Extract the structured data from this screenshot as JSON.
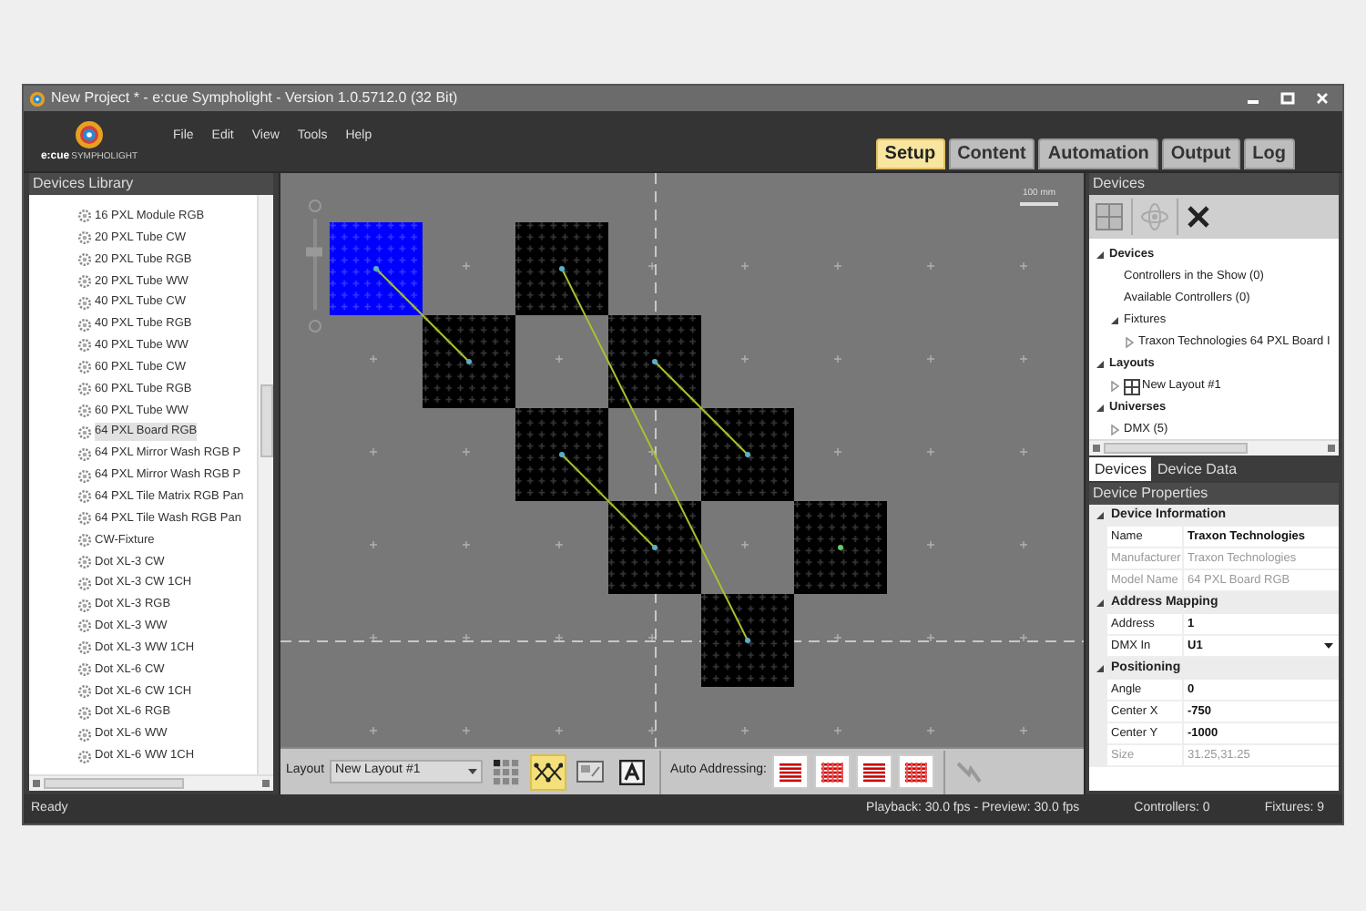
{
  "window": {
    "title": "New Project * - e:cue Sympholight - Version 1.0.5712.0 (32 Bit)"
  },
  "logo": {
    "brand": "e:cue",
    "product": "SYMPHOLIGHT"
  },
  "menu": [
    "File",
    "Edit",
    "View",
    "Tools",
    "Help"
  ],
  "tabs": [
    {
      "label": "Setup",
      "selected": true
    },
    {
      "label": "Content",
      "selected": false
    },
    {
      "label": "Automation",
      "selected": false
    },
    {
      "label": "Output",
      "selected": false
    },
    {
      "label": "Log",
      "selected": false
    }
  ],
  "library": {
    "title": "Devices Library",
    "items": [
      {
        "label": "16 PXL Module RGB",
        "selected": false
      },
      {
        "label": "20 PXL Tube CW",
        "selected": false
      },
      {
        "label": "20 PXL Tube RGB",
        "selected": false
      },
      {
        "label": "20 PXL Tube WW",
        "selected": false
      },
      {
        "label": "40 PXL Tube CW",
        "selected": false
      },
      {
        "label": "40 PXL Tube RGB",
        "selected": false
      },
      {
        "label": "40 PXL Tube WW",
        "selected": false
      },
      {
        "label": "60 PXL Tube CW",
        "selected": false
      },
      {
        "label": "60 PXL Tube RGB",
        "selected": false
      },
      {
        "label": "60 PXL Tube WW",
        "selected": false
      },
      {
        "label": "64 PXL Board RGB",
        "selected": true
      },
      {
        "label": "64 PXL Mirror Wash RGB P",
        "selected": false
      },
      {
        "label": "64 PXL Mirror Wash RGB P",
        "selected": false
      },
      {
        "label": "64 PXL Tile Matrix RGB Pan",
        "selected": false
      },
      {
        "label": "64 PXL Tile Wash RGB Pan",
        "selected": false
      },
      {
        "label": "CW-Fixture",
        "selected": false
      },
      {
        "label": "Dot XL-3 CW",
        "selected": false
      },
      {
        "label": "Dot XL-3 CW 1CH",
        "selected": false
      },
      {
        "label": "Dot XL-3 RGB",
        "selected": false
      },
      {
        "label": "Dot XL-3 WW",
        "selected": false
      },
      {
        "label": "Dot XL-3 WW 1CH",
        "selected": false
      },
      {
        "label": "Dot XL-6 CW",
        "selected": false
      },
      {
        "label": "Dot XL-6 CW 1CH",
        "selected": false
      },
      {
        "label": "Dot XL-6 RGB",
        "selected": false
      },
      {
        "label": "Dot XL-6 WW",
        "selected": false
      },
      {
        "label": "Dot XL-6 WW 1CH",
        "selected": false
      }
    ]
  },
  "canvas": {
    "scale": "100 mm",
    "zoom": {
      "level": 0.65
    },
    "fixtures": [
      {
        "selected": true
      },
      {
        "selected": false
      },
      {
        "selected": false
      },
      {
        "selected": false
      },
      {
        "selected": false
      },
      {
        "selected": false
      },
      {
        "selected": false
      },
      {
        "selected": false
      },
      {
        "selected": false
      }
    ]
  },
  "layout_toolbar": {
    "label": "Layout",
    "layout": "New Layout #1",
    "tools": [
      {
        "kind": "grid",
        "selected": false
      },
      {
        "kind": "wiring",
        "selected": true
      },
      {
        "kind": "image",
        "selected": false
      },
      {
        "kind": "text",
        "selected": false
      }
    ],
    "auto_label": "Auto Addressing:"
  },
  "devices_panel": {
    "title": "Devices",
    "tree": [
      {
        "label": "Devices",
        "expanded": true,
        "children": [
          {
            "label": "Controllers in the Show (0)"
          },
          {
            "label": "Available Controllers (0)"
          },
          {
            "label": "Fixtures",
            "expanded": true,
            "children": [
              {
                "label": "Traxon Technologies 64 PXL Board I",
                "expanded": false
              }
            ]
          }
        ]
      },
      {
        "label": "Layouts",
        "expanded": true,
        "children": [
          {
            "label": "New Layout #1",
            "expanded": false,
            "kind": "layout"
          }
        ]
      },
      {
        "label": "Universes",
        "expanded": true,
        "children": [
          {
            "label": "DMX (5)",
            "expanded": false
          }
        ]
      }
    ],
    "tabs": [
      {
        "label": "Devices",
        "selected": true
      },
      {
        "label": "Device Data",
        "selected": false
      }
    ]
  },
  "properties": {
    "title": "Device Properties",
    "groups": [
      {
        "label": "Device Information",
        "expanded": true,
        "rows": [
          {
            "name": "Name",
            "value": "Traxon Technologies",
            "disabled": false,
            "kind": "text"
          },
          {
            "name": "Manufacturer",
            "value": "Traxon Technologies",
            "disabled": true,
            "kind": "text"
          },
          {
            "name": "Model Name",
            "value": "64 PXL Board RGB",
            "disabled": true,
            "kind": "text"
          }
        ]
      },
      {
        "label": "Address Mapping",
        "expanded": true,
        "rows": [
          {
            "name": "Address",
            "value": "1",
            "disabled": false,
            "kind": "text"
          },
          {
            "name": "DMX In",
            "value": "U1",
            "disabled": false,
            "kind": "dropdown"
          }
        ]
      },
      {
        "label": "Positioning",
        "expanded": true,
        "rows": [
          {
            "name": "Angle",
            "value": "0",
            "disabled": false,
            "kind": "text"
          },
          {
            "name": "Center X",
            "value": "-750",
            "disabled": false,
            "kind": "text"
          },
          {
            "name": "Center Y",
            "value": "-1000",
            "disabled": false,
            "kind": "text"
          },
          {
            "name": "Size",
            "value": "31.25,31.25",
            "disabled": true,
            "kind": "text"
          }
        ]
      }
    ]
  },
  "status_bar": {
    "message": "Ready",
    "playback": "Playback: 30.0 fps - Preview: 30.0 fps",
    "controllers": "Controllers: 0",
    "fixtures": "Fixtures: 9"
  }
}
